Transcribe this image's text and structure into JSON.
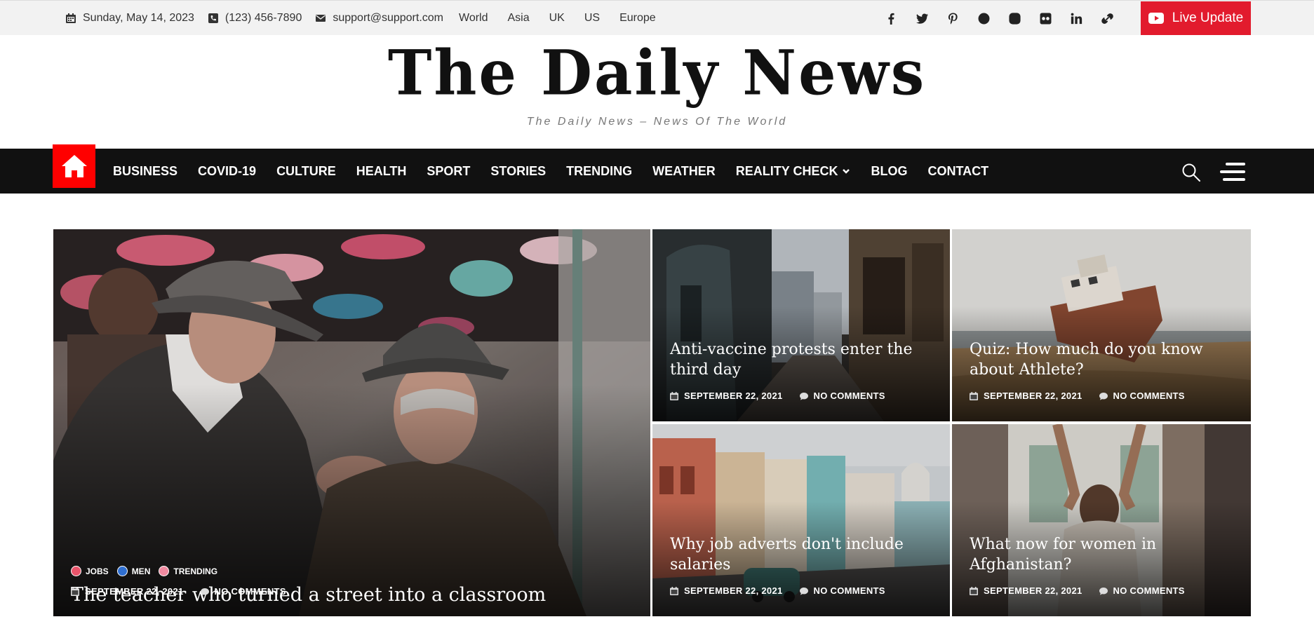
{
  "topbar": {
    "date": "Sunday, May 14, 2023",
    "phone": "(123) 456-7890",
    "email": "support@support.com",
    "regions": [
      "World",
      "Asia",
      "UK",
      "US",
      "Europe"
    ],
    "live_label": "Live Update",
    "live_color": "#e21b2d"
  },
  "masthead": {
    "logo": "The Daily News",
    "tagline": "The Daily News – News Of The World"
  },
  "nav": {
    "home_color": "#ff0000",
    "items": [
      "BUSINESS",
      "COVID-19",
      "CULTURE",
      "HEALTH",
      "SPORT",
      "STORIES",
      "TRENDING",
      "WEATHER",
      "REALITY CHECK",
      "BLOG",
      "CONTACT"
    ]
  },
  "featured": {
    "tags": [
      {
        "label": "JOBS",
        "color": "#e8546a"
      },
      {
        "label": "MEN",
        "color": "#2f6fd1"
      },
      {
        "label": "TRENDING",
        "color": "#f08aa0"
      }
    ],
    "title": "The teacher who turned a street into a classroom",
    "date": "SEPTEMBER 22, 2021",
    "comments": "NO COMMENTS"
  },
  "articles": [
    {
      "title": "Anti-vaccine protests enter the third day",
      "date": "SEPTEMBER 22, 2021",
      "comments": "NO COMMENTS"
    },
    {
      "title": "Quiz: How much do you know about Athlete?",
      "date": "SEPTEMBER 22, 2021",
      "comments": "NO COMMENTS"
    },
    {
      "title": "Why job adverts don't include salaries",
      "date": "SEPTEMBER 22, 2021",
      "comments": "NO COMMENTS"
    },
    {
      "title": "What now for women in Afghanistan?",
      "date": "SEPTEMBER 22, 2021",
      "comments": "NO COMMENTS"
    }
  ]
}
